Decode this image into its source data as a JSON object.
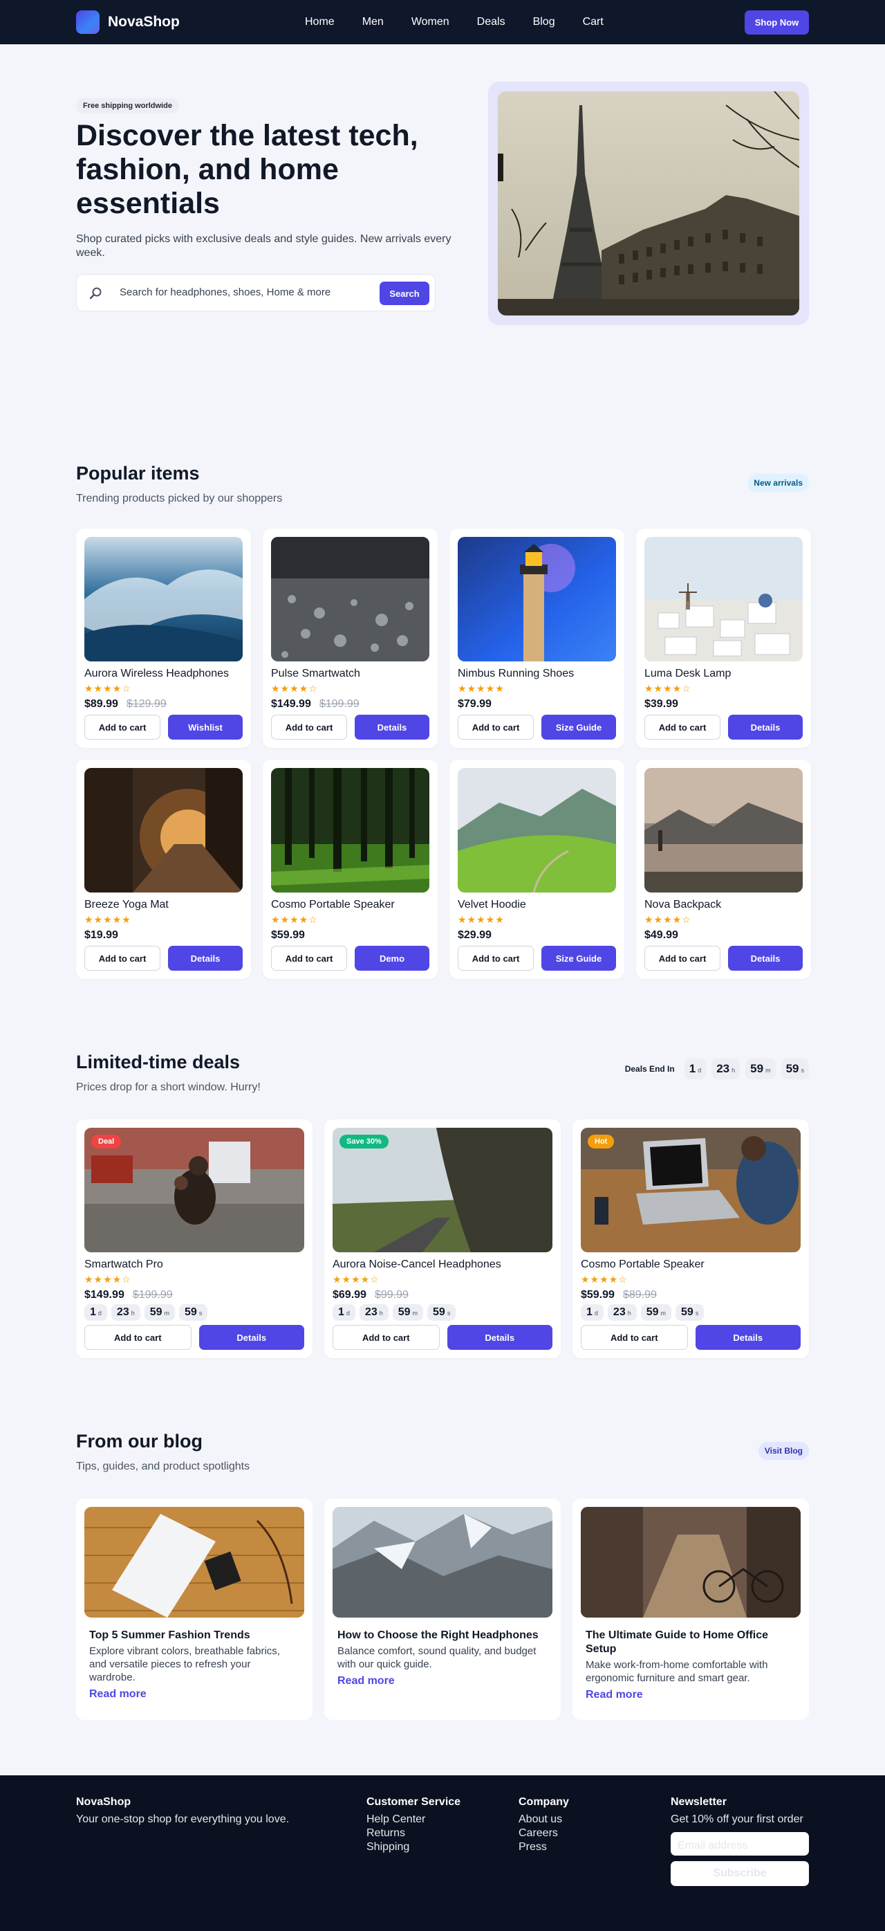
{
  "brand": {
    "name": "NovaShop"
  },
  "nav": {
    "links": [
      "Home",
      "Men",
      "Women",
      "Deals",
      "Blog",
      "Cart"
    ],
    "cta": "Shop Now"
  },
  "hero": {
    "badge": "Free shipping worldwide",
    "title": "Discover the latest tech, fashion, and home essentials",
    "subtitle": "Shop curated picks with exclusive deals and style guides. New arrivals every week.",
    "search_placeholder": "Search for headphones, shoes, Home & more",
    "search_button": "Search",
    "image": "eiffel-tower-photo"
  },
  "popular": {
    "title": "Popular items",
    "subtitle": "Trending products picked by our shoppers",
    "pill": "New arrivals",
    "add_label": "Add to cart",
    "items": [
      {
        "name": "Aurora Wireless Headphones",
        "stars": "★★★★☆",
        "rating": 4,
        "price": "$89.99",
        "old": "$129.99",
        "action": "Wishlist",
        "image": "ocean-wave-photo"
      },
      {
        "name": "Pulse Smartwatch",
        "stars": "★★★★☆",
        "rating": 4,
        "price": "$149.99",
        "old": "$199.99",
        "action": "Details",
        "image": "water-droplets-photo"
      },
      {
        "name": "Nimbus Running Shoes",
        "stars": "★★★★★",
        "rating": 5,
        "price": "$79.99",
        "old": "",
        "action": "Size Guide",
        "image": "lighthouse-photo"
      },
      {
        "name": "Luma Desk Lamp",
        "stars": "★★★★☆",
        "rating": 4,
        "price": "$39.99",
        "old": "",
        "action": "Details",
        "image": "santorini-photo"
      },
      {
        "name": "Breeze Yoga Mat",
        "stars": "★★★★★",
        "rating": 5,
        "price": "$19.99",
        "old": "",
        "action": "Details",
        "image": "city-sunset-photo"
      },
      {
        "name": "Cosmo Portable Speaker",
        "stars": "★★★★☆",
        "rating": 4,
        "price": "$59.99",
        "old": "",
        "action": "Demo",
        "image": "forest-photo"
      },
      {
        "name": "Velvet Hoodie",
        "stars": "★★★★★",
        "rating": 5,
        "price": "$29.99",
        "old": "",
        "action": "Size Guide",
        "image": "green-mountains-photo"
      },
      {
        "name": "Nova Backpack",
        "stars": "★★★★☆",
        "rating": 4,
        "price": "$49.99",
        "old": "",
        "action": "Details",
        "image": "mountain-lake-photo"
      }
    ]
  },
  "deals": {
    "title": "Limited-time deals",
    "subtitle": "Prices drop for a short window. Hurry!",
    "timer_label": "Deals End In",
    "timer": [
      {
        "v": "1",
        "u": "d"
      },
      {
        "v": "23",
        "u": "h"
      },
      {
        "v": "59",
        "u": "m"
      },
      {
        "v": "59",
        "u": "s"
      }
    ],
    "add_label": "Add to cart",
    "items": [
      {
        "name": "Smartwatch Pro",
        "tag": "Deal",
        "tag_color": "#ef4444",
        "stars": "★★★★☆",
        "price": "$149.99",
        "old": "$199.99",
        "action": "Details",
        "image": "street-family-photo"
      },
      {
        "name": "Aurora Noise-Cancel Headphones",
        "tag": "Save 30%",
        "tag_color": "#10b981",
        "stars": "★★★★☆",
        "price": "$69.99",
        "old": "$99.99",
        "action": "Details",
        "image": "cliff-road-photo"
      },
      {
        "name": "Cosmo Portable Speaker",
        "tag": "Hot",
        "tag_color": "#f59e0b",
        "stars": "★★★★☆",
        "price": "$59.99",
        "old": "$89.99",
        "action": "Details",
        "image": "laptop-desk-photo"
      }
    ]
  },
  "blog": {
    "title": "From our blog",
    "subtitle": "Tips, guides, and product spotlights",
    "pill": "Visit Blog",
    "read_more": "Read more",
    "posts": [
      {
        "title": "Top 5 Summer Fashion Trends",
        "desc": "Explore vibrant colors, breathable fabrics, and versatile pieces to refresh your wardrobe.",
        "image": "magazine-table-photo"
      },
      {
        "title": "How to Choose the Right Headphones",
        "desc": "Balance comfort, sound quality, and budget with our quick guide.",
        "image": "snowy-mountains-photo"
      },
      {
        "title": "The Ultimate Guide to Home Office Setup",
        "desc": "Make work-from-home comfortable with ergonomic furniture and smart gear.",
        "image": "bicycle-street-photo"
      }
    ]
  },
  "footer": {
    "brand": "NovaShop",
    "tagline": "Your one-stop shop for everything you love.",
    "cols": [
      {
        "title": "Customer Service",
        "links": [
          "Help Center",
          "Returns",
          "Shipping"
        ]
      },
      {
        "title": "Company",
        "links": [
          "About us",
          "Careers",
          "Press"
        ]
      }
    ],
    "newsletter": {
      "title": "Newsletter",
      "text": "Get 10% off your first order",
      "placeholder": "Email address",
      "button": "Subscribe"
    }
  },
  "colors": {
    "accent": "#4f46e5",
    "nav_bg": "#0f172a",
    "footer_bg": "#0b1120",
    "star": "#f59e0b"
  }
}
